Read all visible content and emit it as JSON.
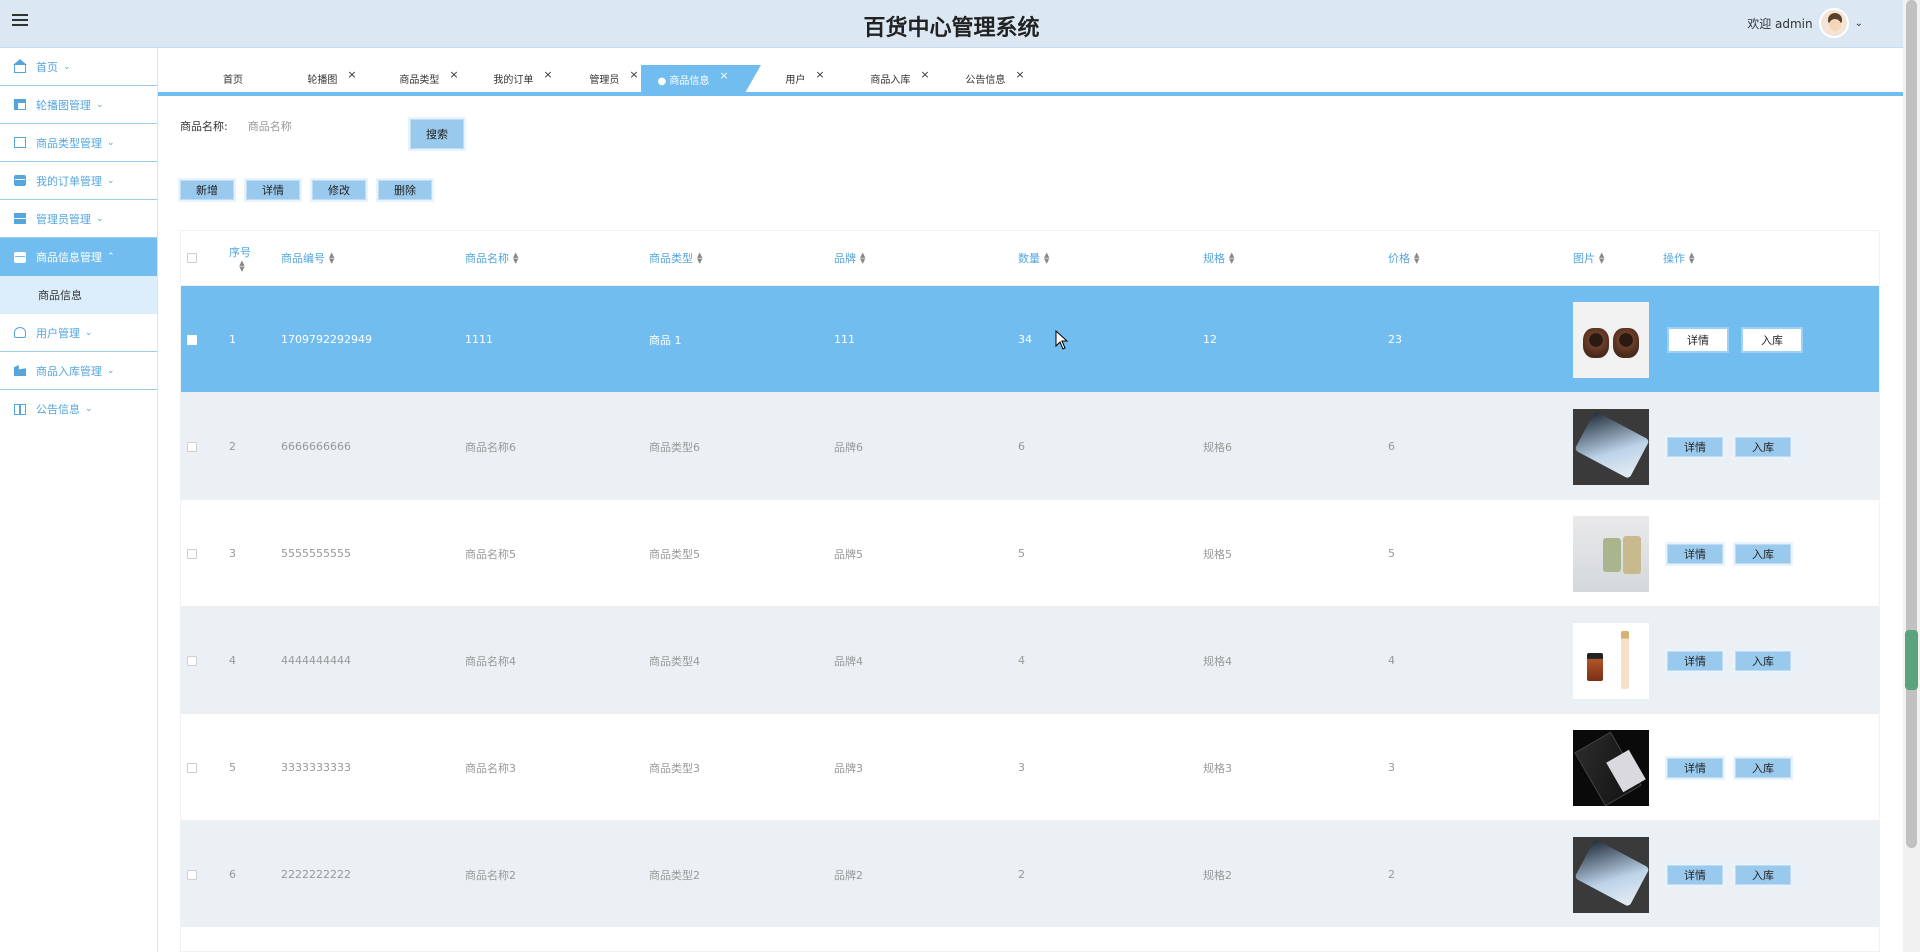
{
  "header": {
    "title": "百货中心管理系统",
    "welcome": "欢迎 admin"
  },
  "sidebar": {
    "items": [
      {
        "label": "首页",
        "icon": "home-icon"
      },
      {
        "label": "轮播图管理",
        "icon": "grid-icon"
      },
      {
        "label": "商品类型管理",
        "icon": "shop-icon"
      },
      {
        "label": "我的订单管理",
        "icon": "box-icon"
      },
      {
        "label": "管理员管理",
        "icon": "stack-icon"
      },
      {
        "label": "商品信息管理",
        "icon": "briefcase-icon",
        "active": true
      },
      {
        "label": "用户管理",
        "icon": "user-icon"
      },
      {
        "label": "商品入库管理",
        "icon": "building-icon"
      },
      {
        "label": "公告信息",
        "icon": "book-icon"
      }
    ],
    "sub_item": "商品信息"
  },
  "tabs": [
    {
      "label": "首页"
    },
    {
      "label": "轮播图"
    },
    {
      "label": "商品类型"
    },
    {
      "label": "我的订单"
    },
    {
      "label": "管理员"
    },
    {
      "label": "● 商品信息",
      "active": true
    },
    {
      "label": "用户"
    },
    {
      "label": "商品入库"
    },
    {
      "label": "公告信息"
    }
  ],
  "search": {
    "label": "商品名称:",
    "placeholder": "商品名称",
    "button": "搜索"
  },
  "actions": {
    "add": "新增",
    "detail": "详情",
    "edit": "修改",
    "delete": "删除"
  },
  "table": {
    "headers": {
      "index": "序号",
      "code": "商品编号",
      "name": "商品名称",
      "type": "商品类型",
      "brand": "品牌",
      "qty": "数量",
      "spec": "规格",
      "price": "价格",
      "image": "图片",
      "ops": "操作"
    },
    "row_buttons": {
      "detail": "详情",
      "stock": "入库"
    },
    "rows": [
      {
        "index": "1",
        "code": "1709792292949",
        "name": "1111",
        "type": "商品 1",
        "brand": "111",
        "qty": "34",
        "spec": "12",
        "price": "23",
        "thumb": "cups"
      },
      {
        "index": "2",
        "code": "6666666666",
        "name": "商品名称6",
        "type": "商品类型6",
        "brand": "品牌6",
        "qty": "6",
        "spec": "规格6",
        "price": "6",
        "thumb": "phone"
      },
      {
        "index": "3",
        "code": "5555555555",
        "name": "商品名称5",
        "type": "商品类型5",
        "brand": "品牌5",
        "qty": "5",
        "spec": "规格5",
        "price": "5",
        "thumb": "bath"
      },
      {
        "index": "4",
        "code": "4444444444",
        "name": "商品名称4",
        "type": "商品类型4",
        "brand": "品牌4",
        "qty": "4",
        "spec": "规格4",
        "price": "4",
        "thumb": "bottle"
      },
      {
        "index": "5",
        "code": "3333333333",
        "name": "商品名称3",
        "type": "商品类型3",
        "brand": "品牌3",
        "qty": "3",
        "spec": "规格3",
        "price": "3",
        "thumb": "dark"
      },
      {
        "index": "6",
        "code": "2222222222",
        "name": "商品名称2",
        "type": "商品类型2",
        "brand": "品牌2",
        "qty": "2",
        "spec": "规格2",
        "price": "2",
        "thumb": "phone"
      }
    ]
  },
  "colors": {
    "accent": "#72bdf0",
    "header_bg": "#dbe8f4",
    "button": "#99c9ec"
  }
}
